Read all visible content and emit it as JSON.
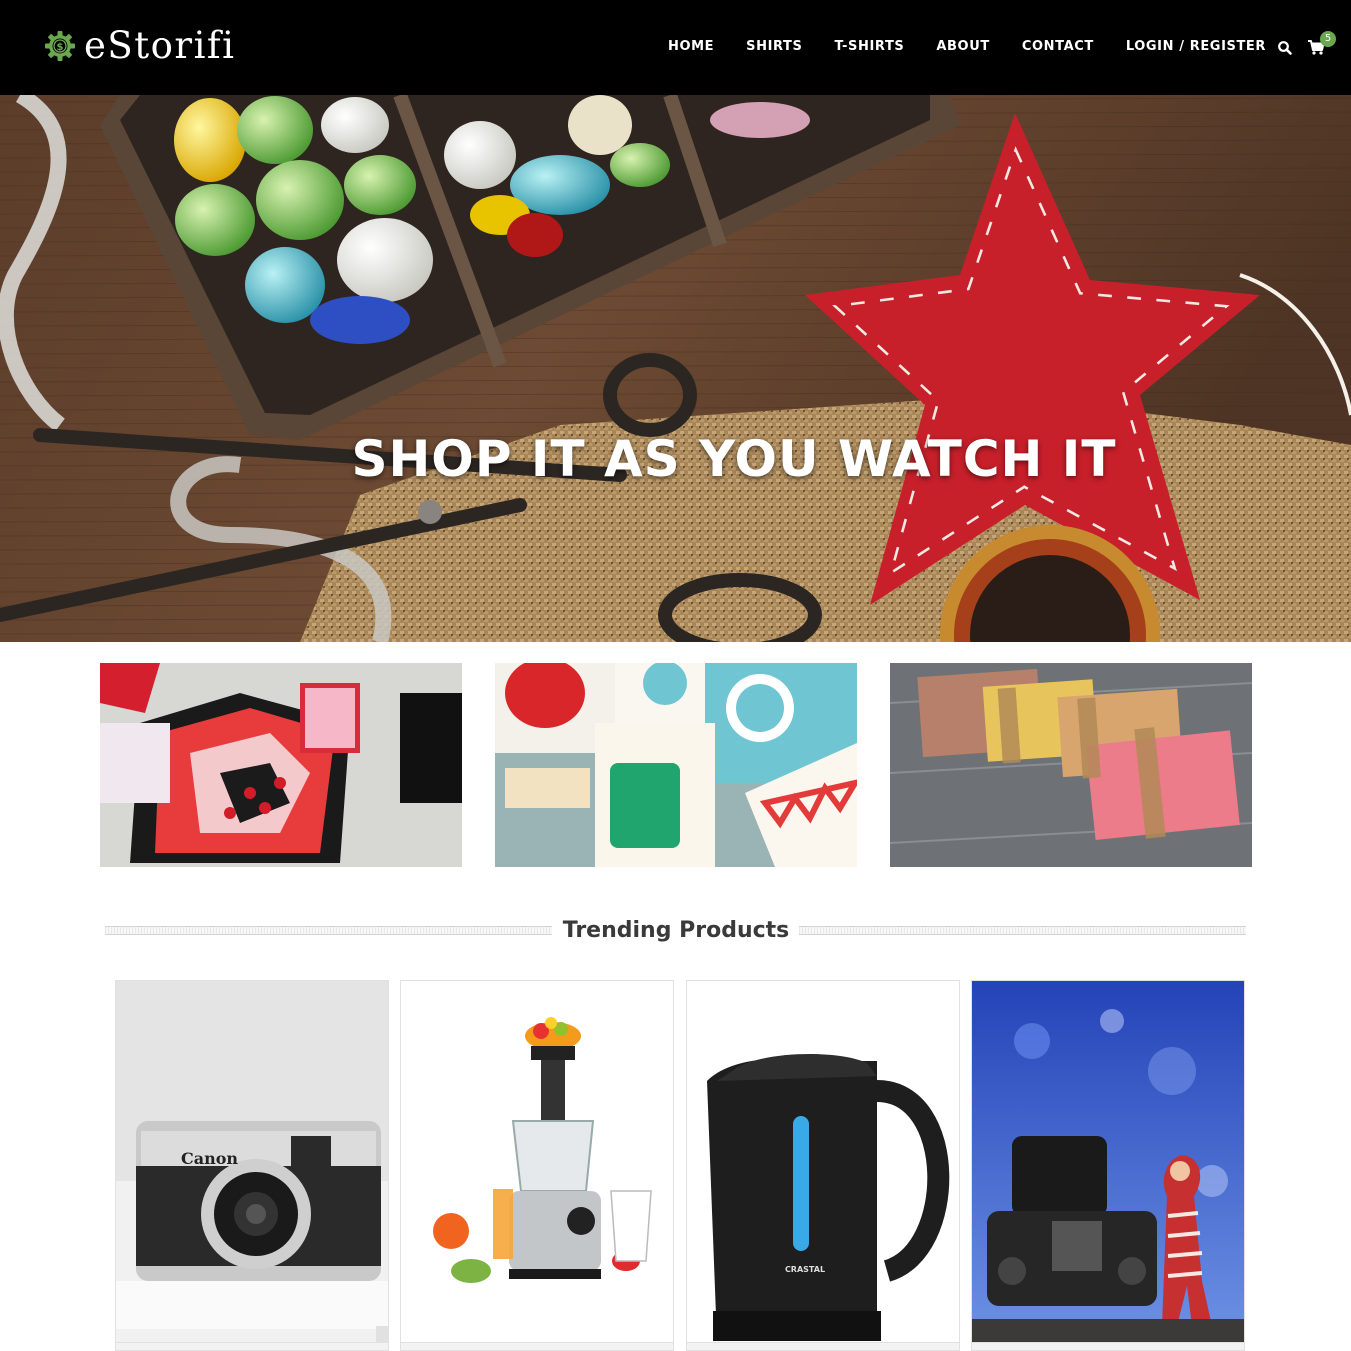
{
  "header": {
    "logo_text": "eStorifi",
    "logo_icon": "dollar-gear-icon",
    "nav": [
      "HOME",
      "SHIRTS",
      "T-SHIRTS",
      "ABOUT",
      "CONTACT",
      "LOGIN / REGISTER"
    ],
    "search_icon": "search-icon",
    "cart_icon": "cart-icon",
    "cart_count": "5"
  },
  "hero": {
    "title": "SHOP IT AS YOU WATCH IT"
  },
  "categories": [
    {
      "image": "gift-box-cards"
    },
    {
      "image": "greeting-cards"
    },
    {
      "image": "handmade-soaps"
    }
  ],
  "trending": {
    "title": "Trending Products",
    "products": [
      {
        "image": "canon-film-camera",
        "brand_text": "Canon"
      },
      {
        "image": "slow-juicer"
      },
      {
        "image": "electric-kettle",
        "brand_text": "CRASTAL"
      },
      {
        "image": "dslr-camera-with-toy"
      }
    ]
  },
  "colors": {
    "header_bg": "#000000",
    "accent_green": "#6aa84f",
    "section_title": "#3a3a3a"
  }
}
